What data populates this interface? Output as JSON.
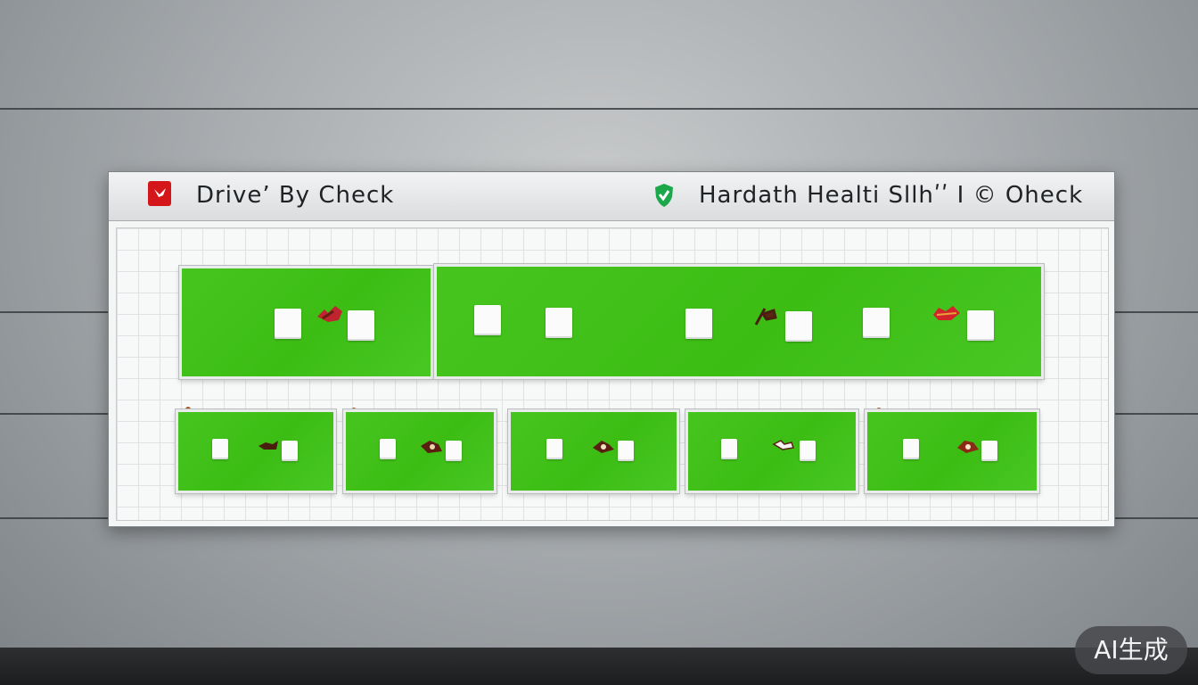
{
  "panel": {
    "left_title": "Driveʼ By Check",
    "right_title": "Hardath Healti Sllhʹʹ I © Oheck",
    "left_icon": "flag-icon",
    "right_icon": "shield-check-icon",
    "left_icon_color": "#d4161b",
    "right_icon_color": "#17a34a"
  },
  "tiles": {
    "color": "#42c21a",
    "top_row_count": 2,
    "bottom_row_count": 5
  },
  "watermark": {
    "label": "AI生成"
  }
}
